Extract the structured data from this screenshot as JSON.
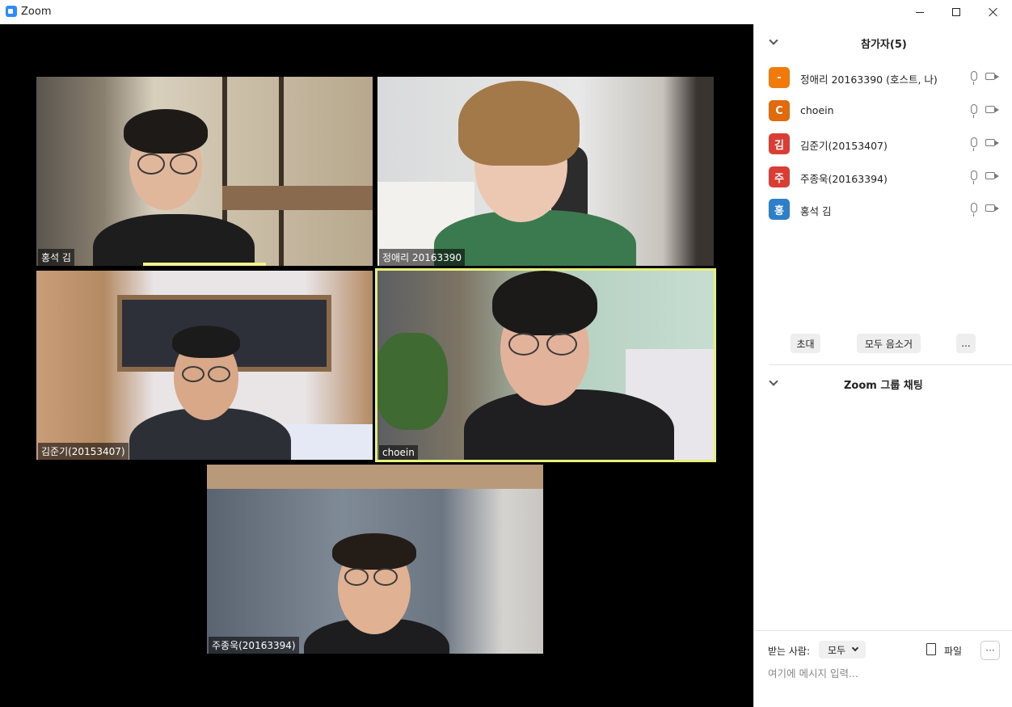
{
  "window": {
    "title": "Zoom"
  },
  "tiles": [
    {
      "label": "홍석 김"
    },
    {
      "label": "정애리 20163390"
    },
    {
      "label": "김준기(20153407)"
    },
    {
      "label": "choein"
    },
    {
      "label": "주종욱(20163394)"
    }
  ],
  "participants_panel": {
    "title": "참가자(5)",
    "participants": [
      {
        "initial": "-",
        "name": "정애리 20163390 (호스트, 나)",
        "color": "#f27a0a"
      },
      {
        "initial": "C",
        "name": "choein",
        "color": "#e06a0c"
      },
      {
        "initial": "김",
        "name": "김준기(20153407)",
        "color": "#d93d33"
      },
      {
        "initial": "주",
        "name": "주종욱(20163394)",
        "color": "#d93d33"
      },
      {
        "initial": "홍",
        "name": "홍석 김",
        "color": "#2d7fc9"
      }
    ],
    "buttons": {
      "invite": "초대",
      "mute_all": "모두 음소거",
      "more": "..."
    }
  },
  "chat_panel": {
    "title": "Zoom 그룹 채팅",
    "to_label": "받는 사람:",
    "to_value": "모두",
    "file_label": "파일",
    "more": "···",
    "placeholder": "여기에 메시지 입력..."
  },
  "colors": {
    "active_speaker": "#f4f28c",
    "video_bg": "#000000"
  }
}
